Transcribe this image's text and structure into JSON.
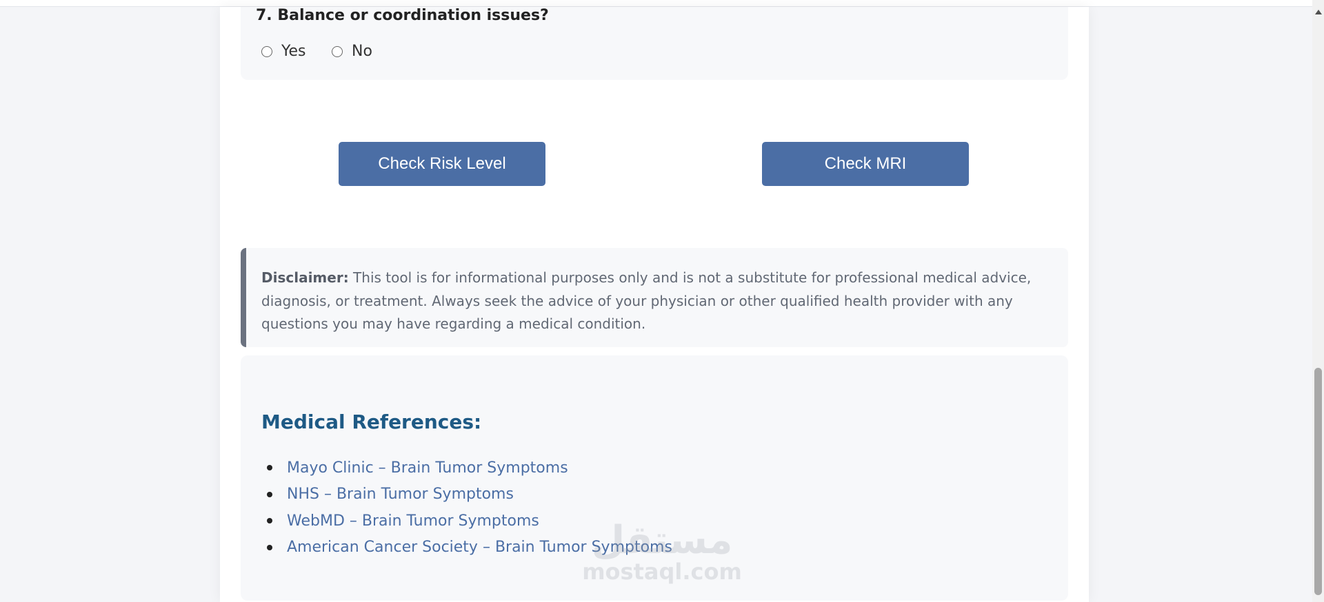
{
  "question": {
    "title": "7. Balance or coordination issues?",
    "options": [
      {
        "label": "Yes",
        "selected": false
      },
      {
        "label": "No",
        "selected": false
      }
    ]
  },
  "buttons": {
    "risk_label": "Check Risk Level",
    "mri_label": "Check MRI"
  },
  "disclaimer": {
    "label": "Disclaimer:",
    "text": " This tool is for informational purposes only and is not a substitute for professional medical advice, diagnosis, or treatment. Always seek the advice of your physician or other qualified health provider with any questions you may have regarding a medical condition."
  },
  "references": {
    "title": "Medical References:",
    "items": [
      {
        "label": "Mayo Clinic – Brain Tumor Symptoms"
      },
      {
        "label": "NHS – Brain Tumor Symptoms"
      },
      {
        "label": "WebMD – Brain Tumor Symptoms"
      },
      {
        "label": "American Cancer Society – Brain Tumor Symptoms"
      }
    ]
  },
  "watermark": {
    "arabic": "مستقل",
    "latin": "mostaql.com"
  },
  "colors": {
    "primary": "#4b6ea5",
    "heading": "#1e5a85",
    "panel": "#f7f8fa",
    "disclaimer_border": "#6b7280"
  }
}
